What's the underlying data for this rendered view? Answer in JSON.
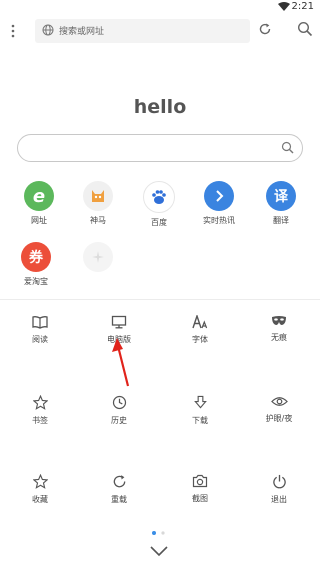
{
  "status": {
    "time": "2:21"
  },
  "toolbar": {
    "address_placeholder": "搜索或网址"
  },
  "home": {
    "title": "hello"
  },
  "shortcuts": [
    {
      "label": "网址",
      "glyph": "e",
      "color": "#5cb85c"
    },
    {
      "label": "神马",
      "glyph": "",
      "color": "#f0f0f0"
    },
    {
      "label": "百度",
      "glyph": "",
      "color": "#ffffff"
    },
    {
      "label": "实时热讯",
      "glyph": "",
      "color": "#3a84e0"
    },
    {
      "label": "翻译",
      "glyph": "译",
      "color": "#3a84e0"
    },
    {
      "label": "爱淘宝",
      "glyph": "券",
      "color": "#ec4f3a"
    },
    {
      "label": "",
      "glyph": "",
      "color": "#f4f4f4"
    }
  ],
  "menu": [
    {
      "label": "阅读",
      "icon": "book-icon"
    },
    {
      "label": "电脑版",
      "icon": "monitor-icon"
    },
    {
      "label": "字体",
      "icon": "font-size-icon"
    },
    {
      "label": "无痕",
      "icon": "mask-icon"
    },
    {
      "label": "书签",
      "icon": "star-icon"
    },
    {
      "label": "历史",
      "icon": "clock-icon"
    },
    {
      "label": "下载",
      "icon": "download-icon"
    },
    {
      "label": "护眼/夜",
      "icon": "eye-icon"
    },
    {
      "label": "收藏",
      "icon": "star-icon"
    },
    {
      "label": "重载",
      "icon": "reload-icon"
    },
    {
      "label": "截图",
      "icon": "camera-icon"
    },
    {
      "label": "退出",
      "icon": "power-icon"
    }
  ],
  "pager": {
    "active_index": 0,
    "count": 2
  }
}
